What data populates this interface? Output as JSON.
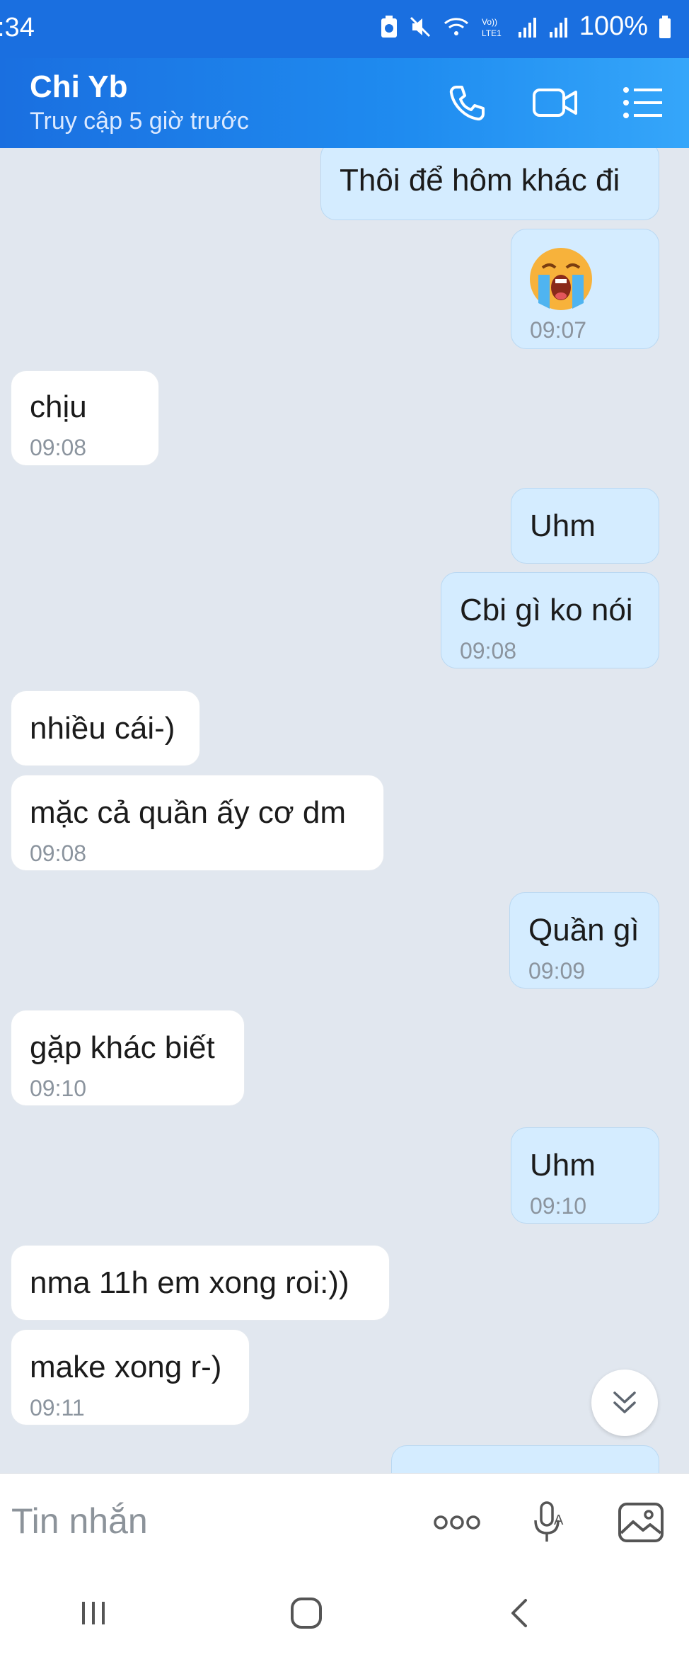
{
  "status_bar": {
    "time": ":34",
    "battery": "100%"
  },
  "header": {
    "contact_name": "Chi Yb",
    "last_seen": "Truy cập 5 giờ trước",
    "icons": [
      "phone-icon",
      "video-call-icon",
      "menu-list-icon"
    ]
  },
  "messages": [
    {
      "dir": "out",
      "text": "Thôi để hôm khác đi",
      "time": ""
    },
    {
      "dir": "out",
      "text": "",
      "emoji": "crying-face-emoji",
      "time": "09:07"
    },
    {
      "dir": "in",
      "text": "chịu",
      "time": "09:08"
    },
    {
      "dir": "out",
      "text": "Uhm",
      "time": ""
    },
    {
      "dir": "out",
      "text": "Cbi gì ko nói",
      "time": "09:08"
    },
    {
      "dir": "in",
      "text": "nhiều cái-)",
      "time": ""
    },
    {
      "dir": "in",
      "text": "mặc cả quần ấy cơ dm",
      "time": "09:08"
    },
    {
      "dir": "out",
      "text": "Quần gì",
      "time": "09:09"
    },
    {
      "dir": "in",
      "text": "gặp khác biết",
      "time": "09:10"
    },
    {
      "dir": "out",
      "text": "Uhm",
      "time": "09:10"
    },
    {
      "dir": "in",
      "text": "nma 11h em xong roi:))",
      "time": ""
    },
    {
      "dir": "in",
      "text": "make xong r-)",
      "time": "09:11"
    }
  ],
  "composer": {
    "placeholder": "Tin nhắn",
    "icons": [
      "more-options-icon",
      "voice-to-text-icon",
      "image-icon"
    ]
  },
  "navigation": {
    "icons": [
      "recent-apps-icon",
      "home-icon",
      "back-icon"
    ]
  }
}
